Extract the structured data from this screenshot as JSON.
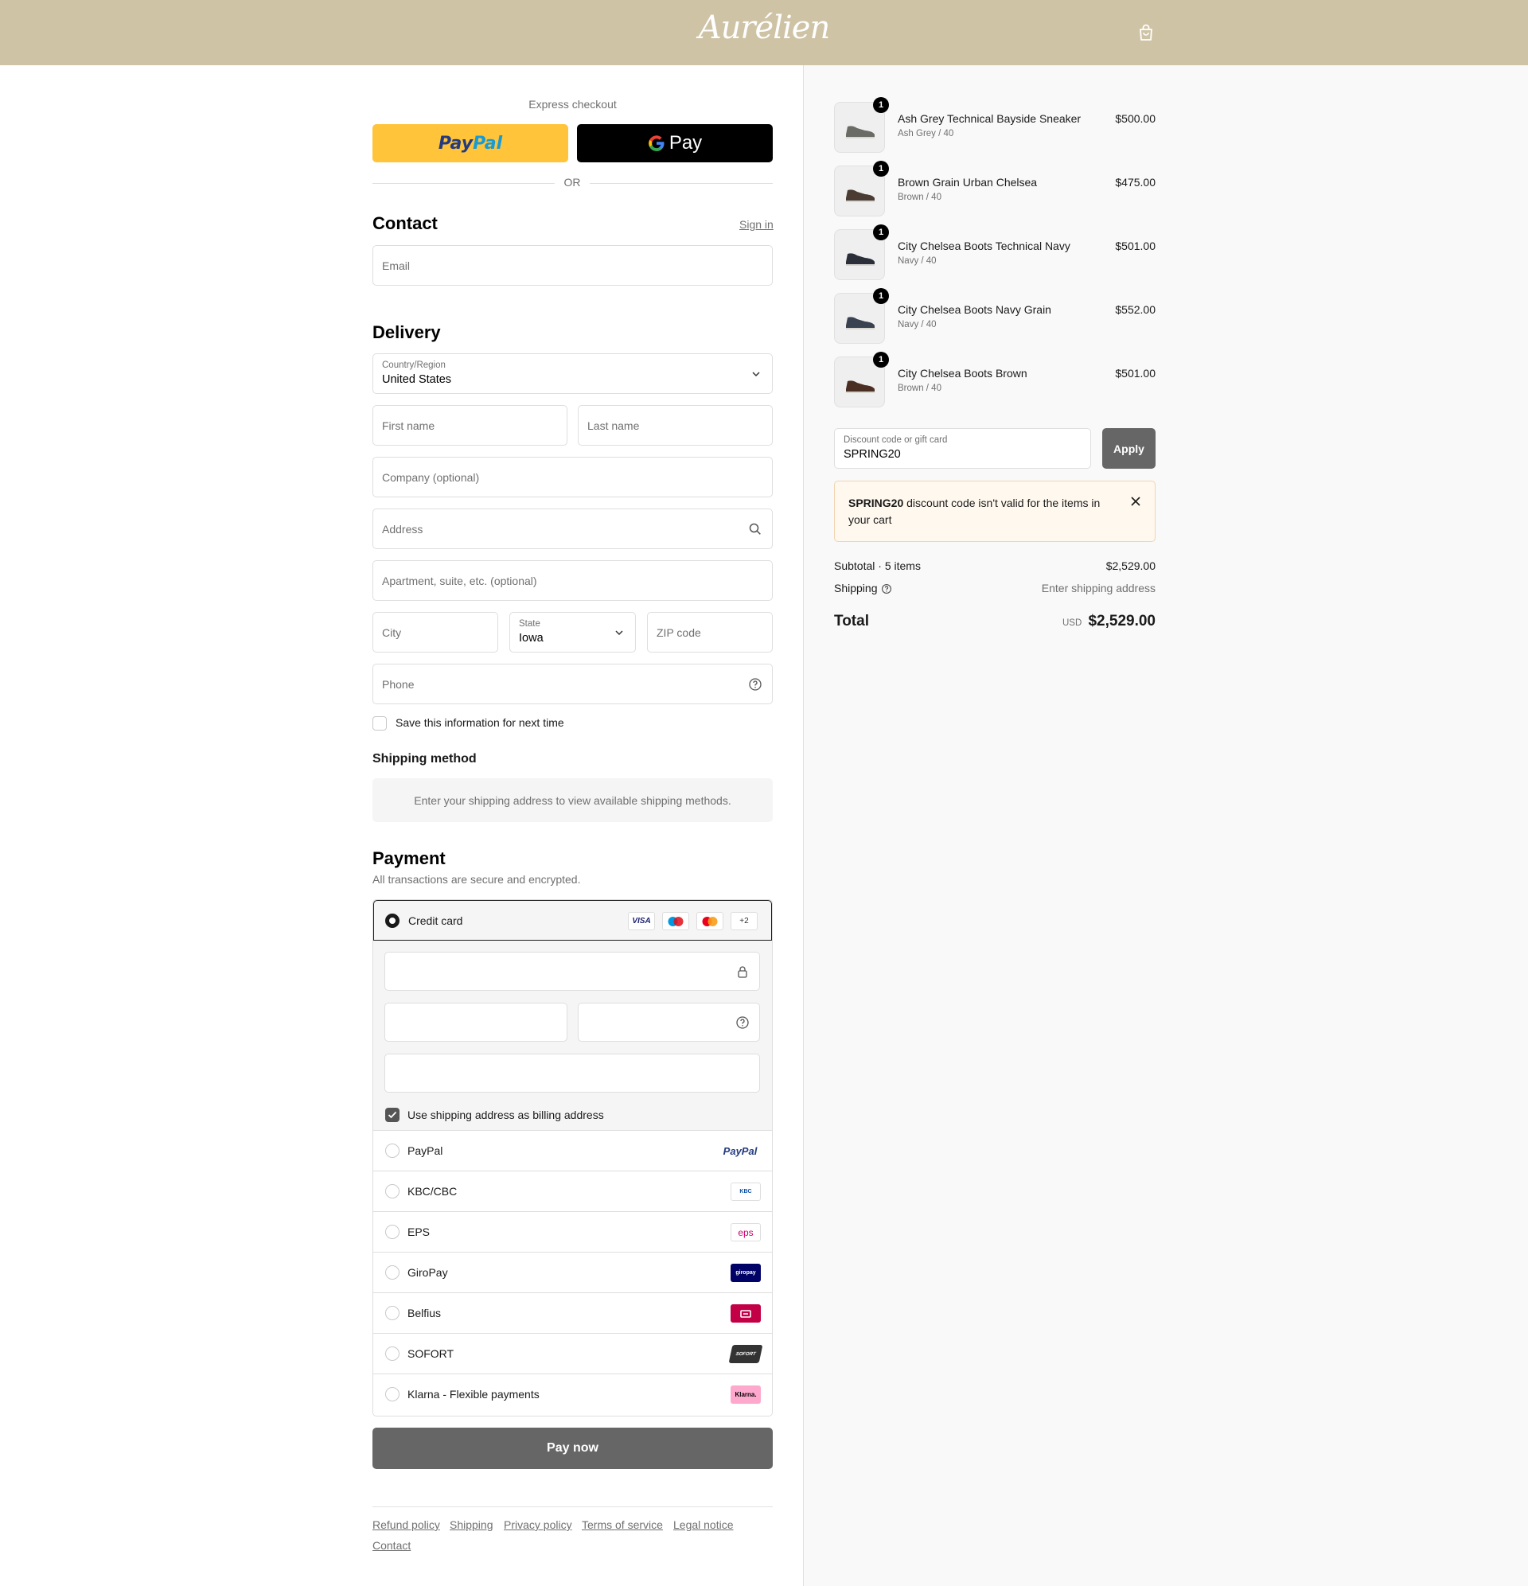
{
  "header": {
    "logo": "Aurélien",
    "cart_icon": "shopping-bag-icon"
  },
  "express": {
    "title": "Express checkout",
    "paypal_label": "PayPal",
    "gpay_label": "Pay",
    "or": "OR"
  },
  "contact": {
    "title": "Contact",
    "signin": "Sign in",
    "email_placeholder": "Email"
  },
  "delivery": {
    "title": "Delivery",
    "country_label": "Country/Region",
    "country_value": "United States",
    "first_name": "First name",
    "last_name": "Last name",
    "company": "Company (optional)",
    "address": "Address",
    "apartment": "Apartment, suite, etc. (optional)",
    "city": "City",
    "state_label": "State",
    "state_value": "Iowa",
    "zip": "ZIP code",
    "phone": "Phone",
    "save_info": "Save this information for next time"
  },
  "shipping_method": {
    "title": "Shipping method",
    "message": "Enter your shipping address to view available shipping methods."
  },
  "payment": {
    "title": "Payment",
    "subtitle": "All transactions are secure and encrypted.",
    "credit_card": "Credit card",
    "card_badges": [
      "VISA",
      "maestro",
      "mastercard",
      "+2"
    ],
    "billing_same": "Use shipping address as billing address",
    "methods": [
      {
        "label": "PayPal",
        "logo": "PayPal"
      },
      {
        "label": "KBC/CBC",
        "logo": "KBC"
      },
      {
        "label": "EPS",
        "logo": "eps"
      },
      {
        "label": "GiroPay",
        "logo": "giropay"
      },
      {
        "label": "Belfius",
        "logo": "belfius"
      },
      {
        "label": "SOFORT",
        "logo": "SOFORT"
      },
      {
        "label": "Klarna - Flexible payments",
        "logo": "Klarna."
      }
    ],
    "pay_now": "Pay now"
  },
  "footer": {
    "links": [
      "Refund policy",
      "Shipping",
      "Privacy policy",
      "Terms of service",
      "Legal notice",
      "Contact"
    ]
  },
  "cart": {
    "items": [
      {
        "name": "Ash Grey Technical Bayside Sneaker",
        "variant": "Ash Grey / 40",
        "price": "$500.00",
        "qty": "1",
        "color": "#6b6b66"
      },
      {
        "name": "Brown Grain Urban Chelsea",
        "variant": "Brown / 40",
        "price": "$475.00",
        "qty": "1",
        "color": "#4a3c33"
      },
      {
        "name": "City Chelsea Boots Technical Navy",
        "variant": "Navy / 40",
        "price": "$501.00",
        "qty": "1",
        "color": "#2a2f3a"
      },
      {
        "name": "City Chelsea Boots Navy Grain",
        "variant": "Navy / 40",
        "price": "$552.00",
        "qty": "1",
        "color": "#3a4150"
      },
      {
        "name": "City Chelsea Boots Brown",
        "variant": "Brown / 40",
        "price": "$501.00",
        "qty": "1",
        "color": "#4b2e22"
      }
    ],
    "discount_label": "Discount code or gift card",
    "discount_value": "SPRING20",
    "apply": "Apply",
    "alert_code": "SPRING20",
    "alert_text": " discount code isn't valid for the items in your cart",
    "subtotal_label": "Subtotal · 5 items",
    "subtotal_value": "$2,529.00",
    "shipping_label": "Shipping",
    "shipping_value": "Enter shipping address",
    "total_label": "Total",
    "total_currency": "USD",
    "total_value": "$2,529.00"
  }
}
